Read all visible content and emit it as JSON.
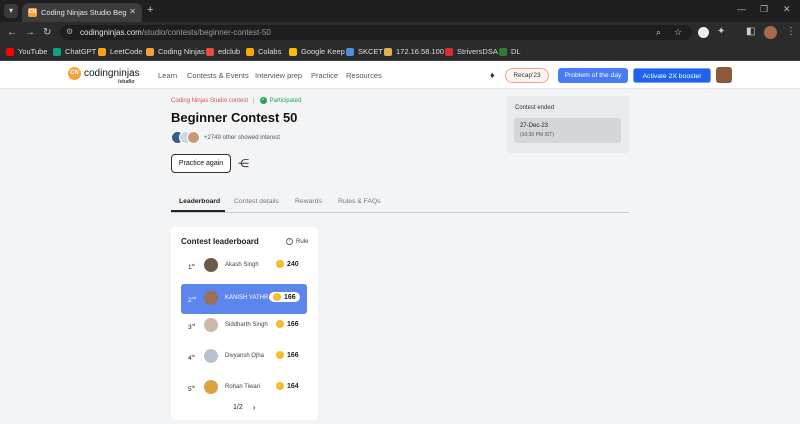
{
  "browser": {
    "tab_title": "Coding Ninjas Studio Beginner",
    "url_host": "codingninjas.com",
    "url_path": "/studio/contests/beginner-contest-50",
    "bookmarks": [
      {
        "label": "YouTube",
        "color": "#ff0000"
      },
      {
        "label": "ChatGPT",
        "color": "#10a37f"
      },
      {
        "label": "LeetCode",
        "color": "#f89f1b"
      },
      {
        "label": "Coding Ninjas",
        "color": "#f4a13a"
      },
      {
        "label": "edclub",
        "color": "#e74c3c"
      },
      {
        "label": "Colabs",
        "color": "#f9ab00"
      },
      {
        "label": "Google Keep",
        "color": "#fbbc04"
      },
      {
        "label": "SKCET",
        "color": "#4a90e2"
      },
      {
        "label": "172.16.58.100",
        "color": "#e0b050"
      },
      {
        "label": "StriversDSA",
        "color": "#d62e2e"
      },
      {
        "label": "DL",
        "color": "#2e7d32"
      }
    ]
  },
  "site": {
    "logo_text": "codingninjas",
    "logo_sub": "/studio",
    "nav": [
      "Learn",
      "Contests & Events",
      "Interview prep",
      "Practice",
      "Resources"
    ],
    "recap_label": "Recap'23",
    "potd_label": "Problem of the day",
    "booster_label": "Activate 2X booster"
  },
  "contest": {
    "breadcrumb_brand": "Coding Ninjas Studio contest",
    "breadcrumb_status": "Participated",
    "title": "Beginner Contest 50",
    "interest_text": "+2749 other showed interest",
    "practice_label": "Practice again",
    "ended_label": "Contest ended",
    "ended_date": "27-Dec-23",
    "ended_time": "(10:30 PM IST)"
  },
  "tabs": [
    "Leaderboard",
    "Contest details",
    "Rewards",
    "Rules & FAQs"
  ],
  "leaderboard": {
    "title": "Contest leaderboard",
    "rule_label": "Rule",
    "rows": [
      {
        "rank": "1",
        "suffix": "st",
        "name": "Akash Singh",
        "score": "240",
        "avatar": "#6b5a45"
      },
      {
        "rank": "2",
        "suffix": "nd",
        "name": "KANISH YATHR...",
        "score": "166",
        "avatar": "#9a7155"
      },
      {
        "rank": "3",
        "suffix": "rd",
        "name": "Siddharth Singh",
        "score": "166",
        "avatar": "#c9b8a8"
      },
      {
        "rank": "4",
        "suffix": "th",
        "name": "Divyansh Ojha",
        "score": "166",
        "avatar": "#b8c2cf"
      },
      {
        "rank": "5",
        "suffix": "th",
        "name": "Rohan Tiwari",
        "score": "164",
        "avatar": "#d9a441"
      }
    ],
    "pager": "1/2"
  }
}
